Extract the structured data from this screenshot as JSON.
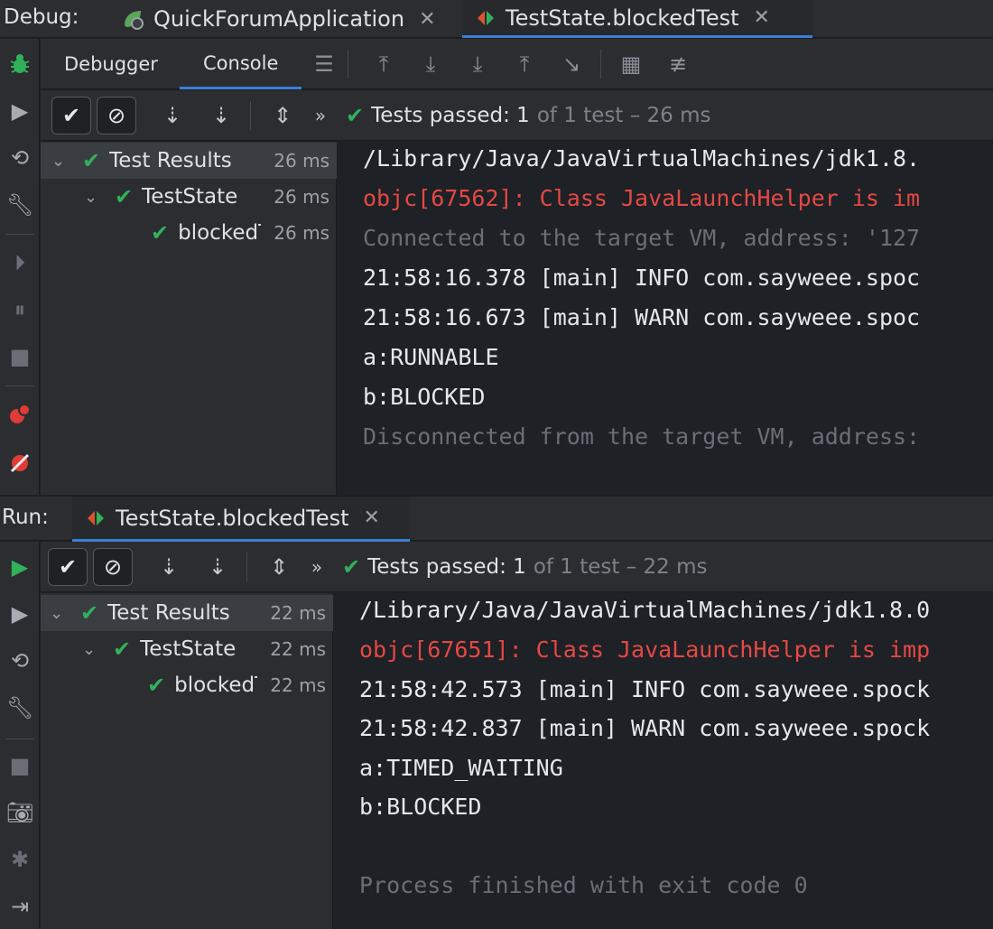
{
  "debug": {
    "label": "Debug:",
    "tabs": [
      {
        "label": "QuickForumApplication",
        "icon": "spring-boot-icon"
      },
      {
        "label": "TestState.blockedTest",
        "icon": "junit-icon"
      }
    ],
    "subtabs": {
      "debugger": "Debugger",
      "console": "Console"
    },
    "status": {
      "check": "✔",
      "passed": "Tests passed: 1",
      "of": "of 1 test – 26 ms"
    },
    "tree": {
      "root": {
        "label": "Test Results",
        "time": "26 ms"
      },
      "class": {
        "label": "TestState",
        "time": "26 ms"
      },
      "method": {
        "label": "blockedTest",
        "time": "26 ms"
      }
    },
    "console": [
      {
        "text": "/Library/Java/JavaVirtualMachines/jdk1.8.",
        "type": "normal"
      },
      {
        "text": "objc[67562]: Class JavaLaunchHelper is im",
        "type": "err"
      },
      {
        "text": "Connected to the target VM, address: '127",
        "type": "dim"
      },
      {
        "text": "21:58:16.378 [main] INFO com.sayweee.spoc",
        "type": "normal"
      },
      {
        "text": "21:58:16.673 [main] WARN com.sayweee.spoc",
        "type": "normal"
      },
      {
        "text": "a:RUNNABLE",
        "type": "normal"
      },
      {
        "text": "b:BLOCKED",
        "type": "normal"
      },
      {
        "text": "Disconnected from the target VM, address:",
        "type": "dim"
      }
    ]
  },
  "run": {
    "label": "Run:",
    "tab": {
      "label": "TestState.blockedTest"
    },
    "status": {
      "check": "✔",
      "passed": "Tests passed: 1",
      "of": "of 1 test – 22 ms"
    },
    "tree": {
      "root": {
        "label": "Test Results",
        "time": "22 ms"
      },
      "class": {
        "label": "TestState",
        "time": "22 ms"
      },
      "method": {
        "label": "blockedTest",
        "time": "22 ms"
      }
    },
    "console": [
      {
        "text": "/Library/Java/JavaVirtualMachines/jdk1.8.0",
        "type": "normal"
      },
      {
        "text": "objc[67651]: Class JavaLaunchHelper is imp",
        "type": "err"
      },
      {
        "text": "21:58:42.573 [main] INFO com.sayweee.spock",
        "type": "normal"
      },
      {
        "text": "21:58:42.837 [main] WARN com.sayweee.spock",
        "type": "normal"
      },
      {
        "text": "a:TIMED_WAITING",
        "type": "normal"
      },
      {
        "text": "b:BLOCKED",
        "type": "normal"
      },
      {
        "text": "",
        "type": "normal"
      },
      {
        "text": "Process finished with exit code 0",
        "type": "dim"
      }
    ]
  },
  "colors": {
    "accent": "#3d7fd6",
    "pass": "#32b05a",
    "error": "#e54845",
    "background": "#1e2125",
    "panel": "#2b2d30"
  }
}
